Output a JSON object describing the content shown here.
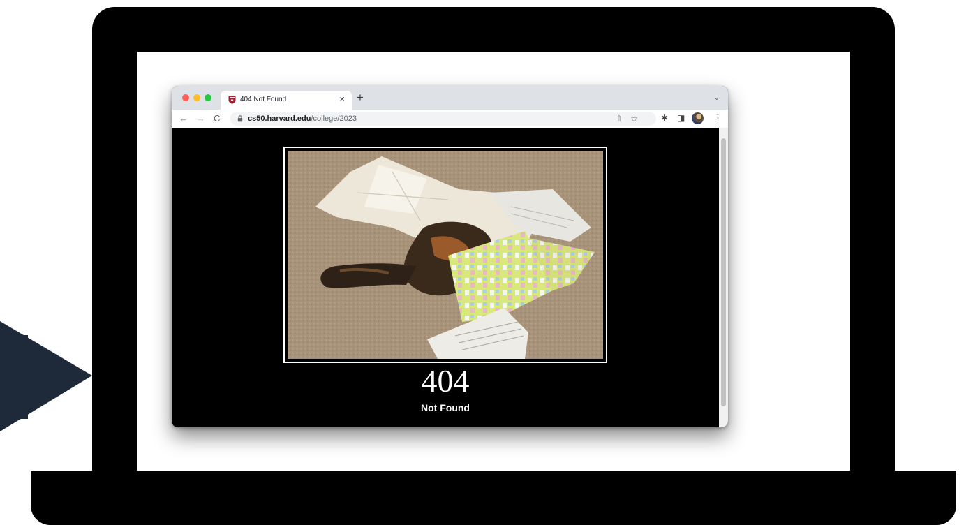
{
  "browser": {
    "tab": {
      "title": "404 Not Found",
      "close": "×"
    },
    "new_tab": "+",
    "tab_menu": "⌄",
    "toolbar": {
      "back": "←",
      "forward": "→",
      "reload": "C",
      "url_host": "cs50.harvard.edu",
      "url_path": "/college/2023",
      "share": "⇧",
      "bookmark": "☆",
      "extensions": "✱",
      "side_panel": "◨",
      "menu": "⋮"
    }
  },
  "page": {
    "error_code": "404",
    "error_text": "Not Found"
  },
  "colors": {
    "navy": "#1e2a39",
    "tabbar": "#dee1e6",
    "page_bg": "#000000"
  }
}
